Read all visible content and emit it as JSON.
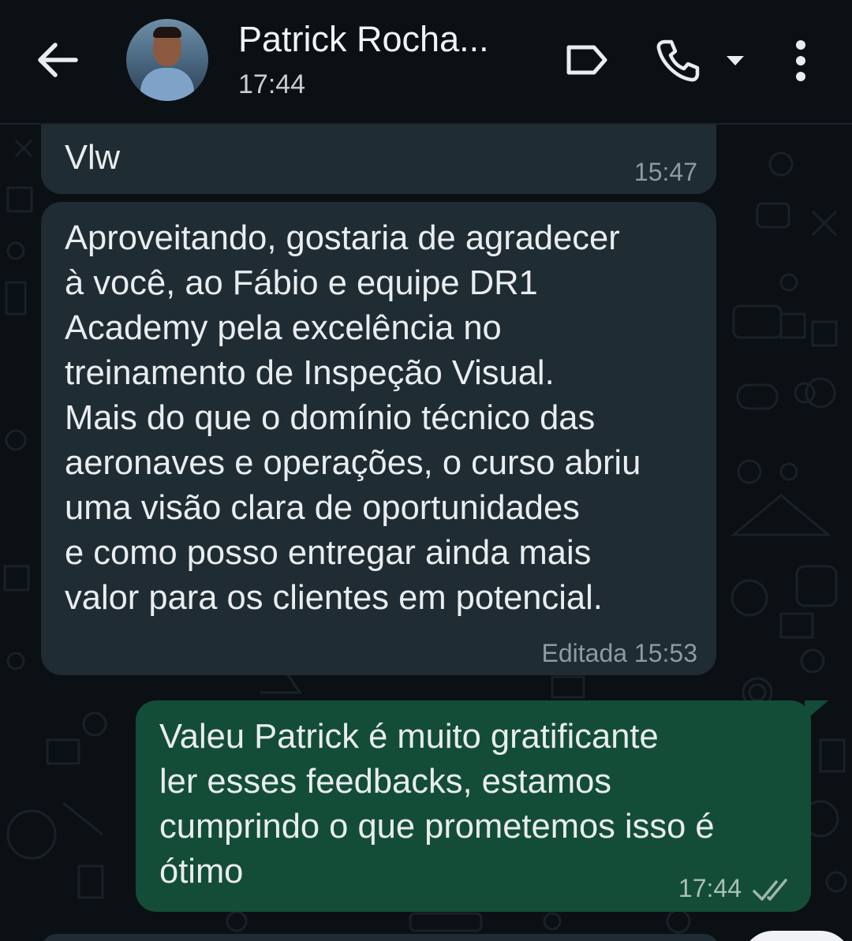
{
  "header": {
    "contact_name": "Patrick Rocha...",
    "last_seen": "17:44",
    "icons": {
      "back": "arrow-left-icon",
      "label": "label-tag-icon",
      "call": "phone-icon",
      "call_dropdown": "caret-down-icon",
      "menu": "more-vertical-icon"
    }
  },
  "messages": [
    {
      "direction": "in",
      "text": "Vlw",
      "time": "15:47"
    },
    {
      "direction": "in",
      "text": "Aproveitando, gostaria de agradecer\nà você, ao Fábio e equipe DR1\nAcademy pela excelência no\ntreinamento de Inspeção Visual.\nMais do que o domínio técnico das\naeronaves e operações, o curso abriu\numa visão clara de oportunidades\ne como posso entregar ainda mais\nvalor para os clientes em potencial.",
      "edited_label": "Editada",
      "time": "15:53"
    },
    {
      "direction": "out",
      "text": "Valeu Patrick é muito gratificante\nler esses feedbacks, estamos\ncumprindo o que prometemos isso é\nótimo",
      "time": "17:44",
      "status": "read-double-check-icon"
    }
  ],
  "colors": {
    "background": "#0b1014",
    "incoming_bubble": "#1f2c33",
    "outgoing_bubble": "#144d37",
    "read_ticks": "#9fb6ab"
  }
}
